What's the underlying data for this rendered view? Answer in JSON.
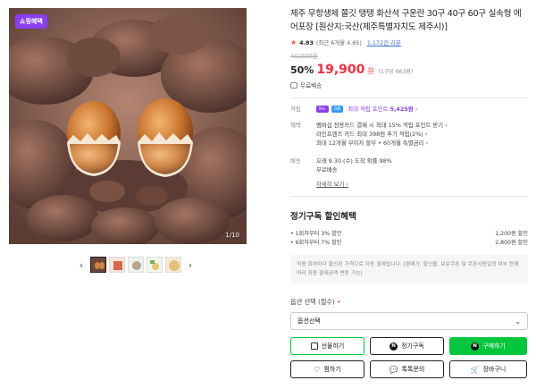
{
  "gallery": {
    "badge": "쇼핑혜택",
    "counter": "1/10",
    "thumb_count": 5,
    "prev_arrow": "‹",
    "next_arrow": "›"
  },
  "product": {
    "title": "제주 무항생제 쫄깃 탱탱 화산석 구운란 30구 40구 60구 실속형 에어포장 [원산지:국산(제주특별자치도 제주시)]",
    "rating": "4.83",
    "rating_detail": "(최근 6개월 4.85)",
    "review_link": "1,172건 리뷰",
    "original_price": "40,000원",
    "discount": "50%",
    "price": "19,900",
    "price_unit": "원",
    "unit_price": "(1구당 663원)",
    "free_shipping_top": "무료배송"
  },
  "benefits": {
    "points_label": "적립",
    "points_badge1": "N+",
    "points_badge2": "GB",
    "points_text": "최대 적립 포인트",
    "points_value": "5,425원",
    "card_label": "혜택",
    "card_lines": [
      "멤버십 전용카드 결제 시 최대 15% 적립 포인트 받기 ›",
      "라인프렌즈 카드 최대 398원 추가 적립(2%) ›",
      "최대 12개월 무이자 할부 • 60개월 특별금리 ›"
    ],
    "delivery_label": "배송",
    "delivery_lines": [
      "오래 9.30 (수) 도착 확률 98%",
      "무료배송"
    ],
    "more_link": "자세히 보기 ›"
  },
  "subscription": {
    "title": "정기구독 할인혜택",
    "rows": [
      {
        "label": "• 1회차부터 3% 할인",
        "value": "1,200원 할인"
      },
      {
        "label": "• 6회차부터 7% 할인",
        "value": "2,800원 할인"
      }
    ],
    "notice": "적용 회차마다 할인된 가격으로 자동 결제됩니다. (판매가, 할인율, 보유쿠폰 및 쿠폰사용일정 여부 등에 따라 최종 결제금액 변동 가능)"
  },
  "options": {
    "label": "옵션 선택 (필수)",
    "required_mark": "•",
    "select_value": "옵션선택"
  },
  "actions": {
    "gift": "선물하기",
    "subscribe": "정기구독",
    "buy": "구매하기",
    "wish": "찜하기",
    "talk": "톡톡문의",
    "cart": "장바구니"
  },
  "colors": {
    "accent_purple": "#8a3ff5",
    "sale_red": "#f52f3e",
    "buy_green": "#00c73c"
  }
}
